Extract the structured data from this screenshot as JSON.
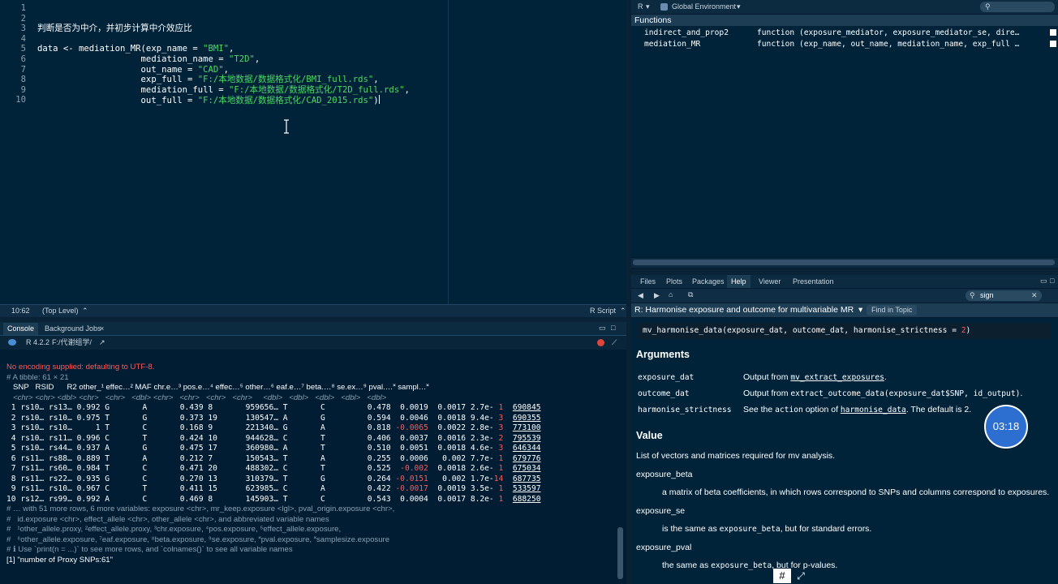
{
  "editor": {
    "lines": [
      {
        "n": "1",
        "t": ""
      },
      {
        "n": "2",
        "t": ""
      },
      {
        "n": "3",
        "t": "判断是否为中介，并初步计算中介效应比"
      },
      {
        "n": "4",
        "t": ""
      },
      {
        "n": "5",
        "pre": "data <- mediation_MR(exp_name = ",
        "s": "\"BMI\"",
        "post": ","
      },
      {
        "n": "6",
        "pre": "                    mediation_name = ",
        "s": "\"T2D\"",
        "post": ","
      },
      {
        "n": "7",
        "pre": "                    out_name = ",
        "s": "\"CAD\"",
        "post": ","
      },
      {
        "n": "8",
        "pre": "                    exp_full = ",
        "s": "\"F:/本地数据/数据格式化/BMI_full.rds\"",
        "post": ","
      },
      {
        "n": "9",
        "pre": "                    mediation_full = ",
        "s": "\"F:/本地数据/数据格式化/T2D_full.rds\"",
        "post": ","
      },
      {
        "n": "10",
        "pre": "                    out_full = ",
        "s": "\"F:/本地数据/数据格式化/CAD_2015.rds\"",
        "post": ")"
      }
    ],
    "status": {
      "position": "10:62",
      "scope": "(Top Level)",
      "filetype": "R Script"
    }
  },
  "console": {
    "tabs": [
      "Console",
      "Background Jobs"
    ],
    "r_version": "R 4.2.2",
    "path": "F:/代谢组学/",
    "lines": {
      "warning": "No encoding supplied: defaulting to UTF-8.",
      "tibble": "# A tibble: 61 × 21",
      "header": "   SNP   RSID      R2 other_¹ effec…² MAF chr.e…³ pos.e…⁴ effec…⁵ other…⁶ eaf.e…⁷ beta.…⁸ se.ex…⁹ pval.…˟ sampl…˟",
      "types": "   <chr> <chr> <dbl> <chr>   <chr>   <dbl> <chr>   <chr>   <chr>   <chr>     <dbl>   <dbl>   <dbl>   <dbl>   <dbl>",
      "more1": "# … with 51 more rows, 6 more variables: exposure <chr>, mr_keep.exposure <lgl>, pval_origin.exposure <chr>,",
      "more2": "#   id.exposure <chr>, effect_allele <chr>, other_allele <chr>, and abbreviated variable names",
      "more3": "#   ¹other_allele.proxy, ²effect_allele.proxy, ³chr.exposure, ⁴pos.exposure, ⁵effect_allele.exposure,",
      "more4": "#   ⁶other_allele.exposure, ⁷eaf.exposure, ⁸beta.exposure, ⁹se.exposure, ˟pval.exposure, ˟samplesize.exposure",
      "hint": "# ℹ Use `print(n = ...)` to see more rows, and `colnames()` to see all variable names",
      "result": "[1] \"number of Proxy SNPs:61\""
    },
    "rows": [
      {
        "i": " 1",
        "snp": "rs10…",
        "rsid": "rs13…",
        "r2": "0.992",
        "oa": "G",
        "ea": "A",
        "maf": "0.439",
        "chr": "8",
        "pos": "959656…",
        "eae": "T",
        "oae": "C",
        "eaf": "0.478",
        "beta": "0.0019",
        "bneg": false,
        "se": "0.0017",
        "p1": "2.7e-",
        "p2": "1",
        "ss": "690845"
      },
      {
        "i": " 2",
        "snp": "rs10…",
        "rsid": "rs10…",
        "r2": "0.975",
        "oa": "T",
        "ea": "G",
        "maf": "0.373",
        "chr": "19",
        "pos": "130547…",
        "eae": "A",
        "oae": "G",
        "eaf": "0.594",
        "beta": "0.0046",
        "bneg": false,
        "se": "0.0018",
        "p1": "9.4e-",
        "p2": "3",
        "ss": "690355"
      },
      {
        "i": " 3",
        "snp": "rs10…",
        "rsid": "rs10…",
        "r2": "1",
        "oa": "T",
        "ea": "C",
        "maf": "0.168",
        "chr": "9",
        "pos": "221340…",
        "eae": "G",
        "oae": "A",
        "eaf": "0.818",
        "beta": "-0.0065",
        "bneg": true,
        "se": "0.0022",
        "p1": "2.8e-",
        "p2": "3",
        "ss": "773100"
      },
      {
        "i": " 4",
        "snp": "rs10…",
        "rsid": "rs11…",
        "r2": "0.996",
        "oa": "C",
        "ea": "T",
        "maf": "0.424",
        "chr": "10",
        "pos": "944628…",
        "eae": "C",
        "oae": "T",
        "eaf": "0.406",
        "beta": "0.0037",
        "bneg": false,
        "se": "0.0016",
        "p1": "2.3e-",
        "p2": "2",
        "ss": "795539"
      },
      {
        "i": " 5",
        "snp": "rs10…",
        "rsid": "rs44…",
        "r2": "0.937",
        "oa": "A",
        "ea": "G",
        "maf": "0.475",
        "chr": "17",
        "pos": "360980…",
        "eae": "A",
        "oae": "T",
        "eaf": "0.510",
        "beta": "0.0051",
        "bneg": false,
        "se": "0.0018",
        "p1": "4.6e-",
        "p2": "3",
        "ss": "646344"
      },
      {
        "i": " 6",
        "snp": "rs11…",
        "rsid": "rs88…",
        "r2": "0.889",
        "oa": "T",
        "ea": "A",
        "maf": "0.212",
        "chr": "7",
        "pos": "150543…",
        "eae": "T",
        "oae": "A",
        "eaf": "0.255",
        "beta": "0.0006",
        "bneg": false,
        "se": "0.002",
        "p1": "7.7e-",
        "p2": "1",
        "ss": "679776"
      },
      {
        "i": " 7",
        "snp": "rs11…",
        "rsid": "rs60…",
        "r2": "0.984",
        "oa": "T",
        "ea": "C",
        "maf": "0.471",
        "chr": "20",
        "pos": "488302…",
        "eae": "C",
        "oae": "T",
        "eaf": "0.525",
        "beta": "-0.002",
        "bneg": true,
        "se": "0.0018",
        "p1": "2.6e-",
        "p2": "1",
        "ss": "675034"
      },
      {
        "i": " 8",
        "snp": "rs11…",
        "rsid": "rs22…",
        "r2": "0.935",
        "oa": "G",
        "ea": "C",
        "maf": "0.270",
        "chr": "13",
        "pos": "310379…",
        "eae": "T",
        "oae": "G",
        "eaf": "0.264",
        "beta": "-0.0151",
        "bneg": true,
        "se": "0.002",
        "p1": "1.7e-",
        "p2": "14",
        "ss": "687735"
      },
      {
        "i": " 9",
        "snp": "rs11…",
        "rsid": "rs10…",
        "r2": "0.967",
        "oa": "C",
        "ea": "T",
        "maf": "0.411",
        "chr": "15",
        "pos": "623985…",
        "eae": "C",
        "oae": "A",
        "eaf": "0.422",
        "beta": "-0.0017",
        "bneg": true,
        "se": "0.0019",
        "p1": "3.5e-",
        "p2": "1",
        "ss": "533597"
      },
      {
        "i": "10",
        "snp": "rs12…",
        "rsid": "rs99…",
        "r2": "0.992",
        "oa": "A",
        "ea": "C",
        "maf": "0.469",
        "chr": "8",
        "pos": "145903…",
        "eae": "T",
        "oae": "C",
        "eaf": "0.543",
        "beta": "0.0004",
        "bneg": false,
        "se": "0.0017",
        "p1": "8.2e-",
        "p2": "1",
        "ss": "688250"
      }
    ]
  },
  "environment": {
    "lang": "R",
    "env_select": "Global Environment",
    "section": "Functions",
    "items": [
      {
        "name": "indirect_and_prop2",
        "value": "function (exposure_mediator, exposure_mediator_se, dire…"
      },
      {
        "name": "mediation_MR",
        "value": "function (exp_name, out_name, mediation_name, exp_full …"
      }
    ]
  },
  "help": {
    "tabs": [
      "Files",
      "Plots",
      "Packages",
      "Help",
      "Viewer",
      "Presentation"
    ],
    "active_tab": "Help",
    "search_value": "sign",
    "topic_title": "R: Harmonise exposure and outcome for multivariable MR",
    "find_in_topic": "Find in Topic",
    "usage": {
      "pre": "mv_harmonise_data(exposure_dat, outcome_dat, harmonise_strictness = ",
      "num": "2",
      "post": ")"
    },
    "arguments_heading": "Arguments",
    "args": [
      {
        "name": "exposure_dat",
        "d1": "Output from ",
        "code": "mv_extract_exposures",
        "d2": "."
      },
      {
        "name": "outcome_dat",
        "d1": "Output from ",
        "code": "extract_outcome_data(exposure_dat$SNP, id_output)",
        "d2": "."
      },
      {
        "name": "harmonise_strictness",
        "d1": "See the ",
        "code": "action",
        "d2": " option of ",
        "code2": "harmonise_data",
        "d3": ". The default is 2."
      }
    ],
    "value_heading": "Value",
    "value_text": "List of vectors and matrices required for mv analysis.",
    "v1_name": "exposure_beta",
    "v1_desc": "a matrix of beta coefficients, in which rows correspond to SNPs and columns correspond to exposures.",
    "v2_name": "exposure_se",
    "v2_desc_pre": "is the same as ",
    "v2_code": "exposure_beta",
    "v2_desc_post": ", but for standard errors.",
    "v3_name": "exposure_pval",
    "v3_desc_pre": "the same as ",
    "v3_code": "exposure_beta",
    "v3_desc_post": ", but for p-values.",
    "timer": "03:18"
  }
}
